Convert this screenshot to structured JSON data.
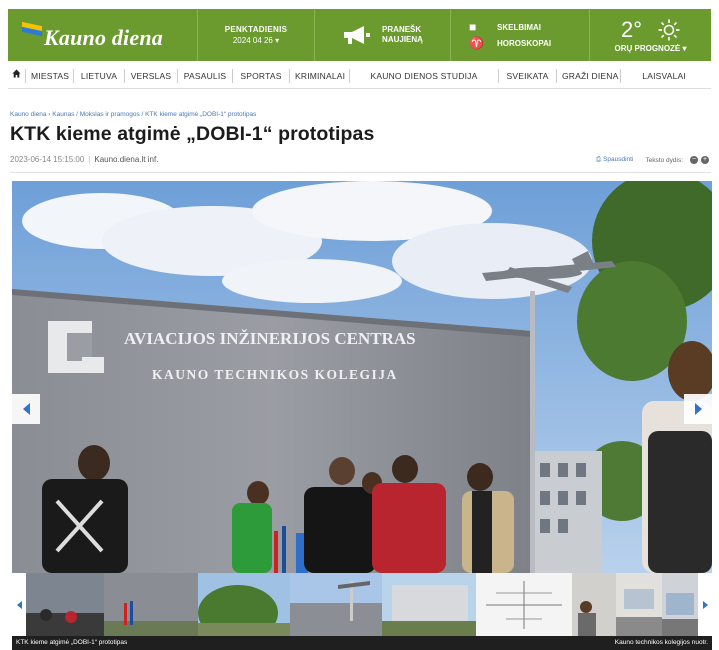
{
  "header": {
    "logo": "Kauno diena",
    "date_day": "PENKTADIENIS",
    "date_value": "2024 04 26",
    "date_caret": "▾",
    "report_line1": "PRANEŠK",
    "report_line2": "NAUJIENĄ",
    "ads_label": "SKELBIMAI",
    "horoscope_label": "HOROSKOPAI",
    "temperature": "2°",
    "weather_label": "ORŲ PROGNOZĖ",
    "weather_caret": "▾",
    "colors": {
      "brand_green": "#6b9a2e",
      "link_blue": "#4a79b5"
    },
    "icons": [
      "megaphone-icon",
      "ads-icon",
      "horoscope-icon",
      "sun-icon"
    ]
  },
  "nav": {
    "home_icon": "home-icon",
    "items": [
      "MIESTAS",
      "LIETUVA",
      "VERSLAS",
      "PASAULIS",
      "SPORTAS",
      "KRIMINALAI",
      "KAUNO DIENOS STUDIJA",
      "SVEIKATA",
      "GRAŽI DIENA",
      "LAISVALAI"
    ]
  },
  "article": {
    "breadcrumb": "Kauno diena › Kaunas / Mokslas ir pramogos / KTK kieme atgimė „DOBI-1“ prototipas",
    "title": "KTK kieme atgimė „DOBI-1“ prototipas",
    "datetime": "2023-06-14 15:15:00",
    "source": "Kauno.diena.lt inf.",
    "print_label": "Spausdinti",
    "text_size_label": "Teksto dydis:",
    "minus_symbol": "−",
    "plus_symbol": "+"
  },
  "photo": {
    "sign_line1": "AVIACIJOS INŽINERIJOS CENTRAS",
    "sign_line2": "KAUNO TECHNIKOS KOLEGIJA",
    "caption_left": "KTK kieme atgimė „DOBI-1“ prototipas",
    "caption_right": "Kauno technikos kolegijos nuotr."
  }
}
